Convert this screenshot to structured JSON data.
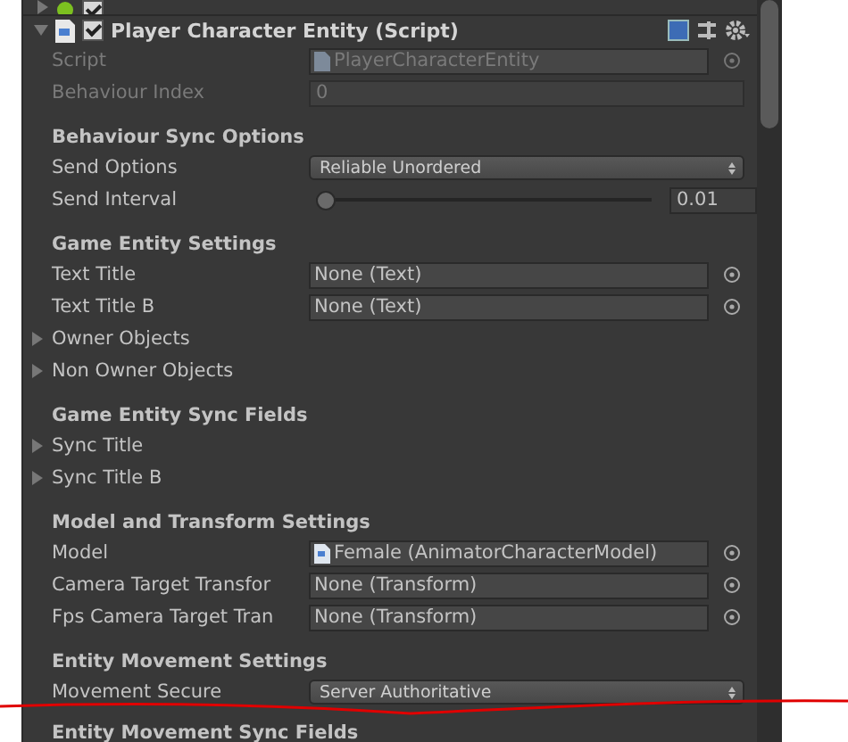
{
  "previous_component": {
    "enabled": true
  },
  "component": {
    "title": "Player Character Entity (Script)",
    "enabled": true,
    "expanded": true
  },
  "fields": [
    {
      "kind": "script",
      "label": "Script",
      "value": "PlayerCharacterEntity"
    },
    {
      "kind": "readonly",
      "label": "Behaviour Index",
      "value": "0"
    }
  ],
  "sections": [
    {
      "heading": "Behaviour Sync Options",
      "rows": [
        {
          "kind": "dropdown",
          "label": "Send Options",
          "value": "Reliable Unordered"
        },
        {
          "kind": "slider",
          "label": "Send Interval",
          "level": 0,
          "value": "0.01"
        }
      ]
    },
    {
      "heading": "Game Entity Settings",
      "rows": [
        {
          "kind": "object",
          "label": "Text Title",
          "value": "None (Text)"
        },
        {
          "kind": "object",
          "label": "Text Title B",
          "value": "None (Text)"
        },
        {
          "kind": "foldout",
          "label": "Owner Objects",
          "expanded": false
        },
        {
          "kind": "foldout",
          "label": "Non Owner Objects",
          "expanded": false
        }
      ]
    },
    {
      "heading": "Game Entity Sync Fields",
      "rows": [
        {
          "kind": "foldout",
          "label": "Sync Title",
          "expanded": false
        },
        {
          "kind": "foldout",
          "label": "Sync Title B",
          "expanded": false
        }
      ]
    },
    {
      "heading": "Model and Transform Settings",
      "rows": [
        {
          "kind": "asset",
          "label": "Model",
          "value": "Female (AnimatorCharacterModel)"
        },
        {
          "kind": "object",
          "label": "Camera Target Transfor",
          "value": "None (Transform)"
        },
        {
          "kind": "object",
          "label": "Fps Camera Target Tran",
          "value": "None (Transform)"
        }
      ]
    },
    {
      "heading": "Entity Movement Settings",
      "rows": [
        {
          "kind": "dropdown",
          "label": "Movement Secure",
          "value": "Server Authoritative"
        }
      ]
    },
    {
      "heading": "Entity Movement Sync Fields"
    }
  ]
}
